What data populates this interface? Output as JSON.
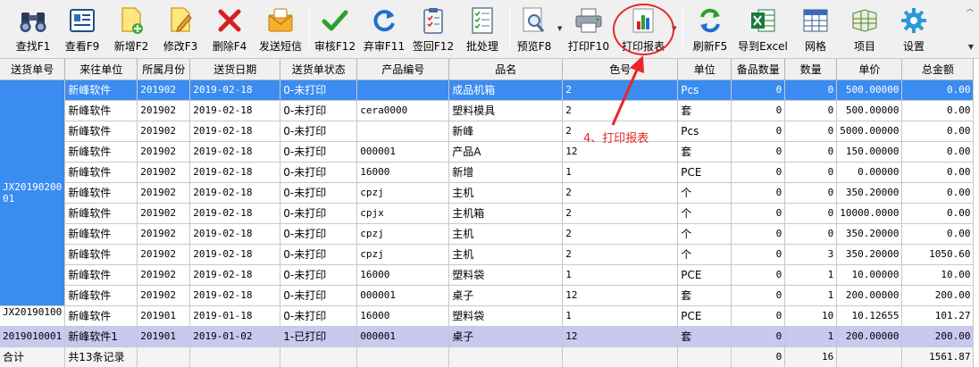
{
  "toolbar": {
    "buttons": [
      {
        "label": "查找F1",
        "icon": "binoculars-icon"
      },
      {
        "label": "查看F9",
        "icon": "view-card-icon"
      },
      {
        "label": "新增F2",
        "icon": "new-doc-icon"
      },
      {
        "label": "修改F3",
        "icon": "edit-doc-icon"
      },
      {
        "label": "删除F4",
        "icon": "delete-x-icon"
      },
      {
        "label": "发送短信",
        "icon": "sms-envelope-icon"
      },
      {
        "label": "审核F12",
        "icon": "checkmark-icon"
      },
      {
        "label": "弃审F11",
        "icon": "refresh-arrow-icon"
      },
      {
        "label": "签回F12",
        "icon": "clipboard-icon"
      },
      {
        "label": "批处理",
        "icon": "checklist-icon"
      },
      {
        "label": "预览F8",
        "icon": "magnifier-icon"
      },
      {
        "label": "打印F10",
        "icon": "printer-icon"
      },
      {
        "label": "打印报表",
        "icon": "bar-chart-icon"
      },
      {
        "label": "刷新F5",
        "icon": "refresh-icon"
      },
      {
        "label": "导到Excel",
        "icon": "excel-icon"
      },
      {
        "label": "网格",
        "icon": "grid-icon"
      },
      {
        "label": "项目",
        "icon": "project-icon"
      },
      {
        "label": "设置",
        "icon": "gear-icon"
      }
    ]
  },
  "annotation": {
    "text": "4、打印报表",
    "color": "#e8262a"
  },
  "table": {
    "headers": [
      "送货单号",
      "来往单位",
      "所属月份",
      "送货日期",
      "送货单状态",
      "产品编号",
      "品名",
      "色号",
      "单位",
      "备品数量",
      "数量",
      "单价",
      "总金额"
    ],
    "group1": "JX2019020001",
    "group2": "JX20190100",
    "group3": "2019010001",
    "rows": [
      [
        "新峰软件",
        "201902",
        "2019-02-18",
        "0-未打印",
        "",
        "成品机箱",
        "2",
        "Pcs",
        "0",
        "0",
        "500.00000",
        "0.00"
      ],
      [
        "新峰软件",
        "201902",
        "2019-02-18",
        "0-未打印",
        "cera0000",
        "塑料模具",
        "2",
        "套",
        "0",
        "0",
        "500.00000",
        "0.00"
      ],
      [
        "新峰软件",
        "201902",
        "2019-02-18",
        "0-未打印",
        "",
        "新峰",
        "2",
        "Pcs",
        "0",
        "0",
        "5000.00000",
        "0.00"
      ],
      [
        "新峰软件",
        "201902",
        "2019-02-18",
        "0-未打印",
        "000001",
        "产品A",
        "12",
        "套",
        "0",
        "0",
        "150.00000",
        "0.00"
      ],
      [
        "新峰软件",
        "201902",
        "2019-02-18",
        "0-未打印",
        "16000",
        "新增",
        "1",
        "PCE",
        "0",
        "0",
        "0.00000",
        "0.00"
      ],
      [
        "新峰软件",
        "201902",
        "2019-02-18",
        "0-未打印",
        "cpzj",
        "主机",
        "2",
        "个",
        "0",
        "0",
        "350.20000",
        "0.00"
      ],
      [
        "新峰软件",
        "201902",
        "2019-02-18",
        "0-未打印",
        "cpjx",
        "主机箱",
        "2",
        "个",
        "0",
        "0",
        "10000.0000",
        "0.00"
      ],
      [
        "新峰软件",
        "201902",
        "2019-02-18",
        "0-未打印",
        "cpzj",
        "主机",
        "2",
        "个",
        "0",
        "0",
        "350.20000",
        "0.00"
      ],
      [
        "新峰软件",
        "201902",
        "2019-02-18",
        "0-未打印",
        "cpzj",
        "主机",
        "2",
        "个",
        "0",
        "3",
        "350.20000",
        "1050.60"
      ],
      [
        "新峰软件",
        "201902",
        "2019-02-18",
        "0-未打印",
        "16000",
        "塑料袋",
        "1",
        "PCE",
        "0",
        "1",
        "10.00000",
        "10.00"
      ],
      [
        "新峰软件",
        "201902",
        "2019-02-18",
        "0-未打印",
        "000001",
        "桌子",
        "12",
        "套",
        "0",
        "1",
        "200.00000",
        "200.00"
      ],
      [
        "新峰软件",
        "201901",
        "2019-01-18",
        "0-未打印",
        "16000",
        "塑料袋",
        "1",
        "PCE",
        "0",
        "10",
        "10.12655",
        "101.27"
      ],
      [
        "新峰软件1",
        "201901",
        "2019-01-02",
        "1-已打印",
        "000001",
        "桌子",
        "12",
        "套",
        "0",
        "1",
        "200.00000",
        "200.00"
      ]
    ],
    "total": {
      "label": "合计",
      "count": "共13条记录",
      "spare": "0",
      "qty": "16",
      "amount": "1561.87"
    }
  }
}
